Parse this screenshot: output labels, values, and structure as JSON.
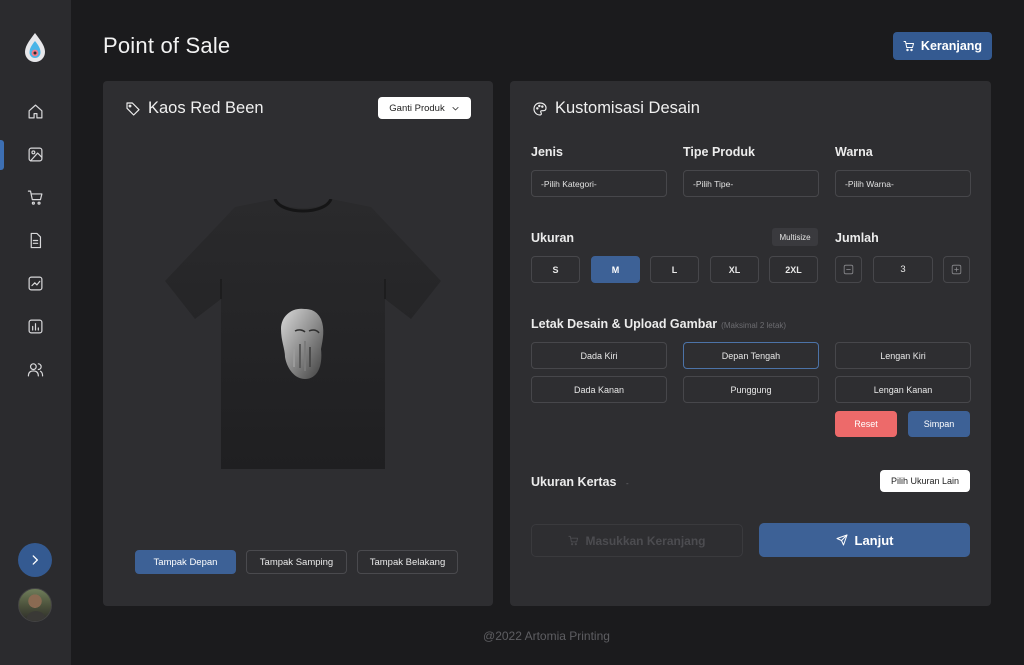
{
  "header": {
    "title": "Point of Sale",
    "cart_label": "Keranjang"
  },
  "sidebar": {
    "items": [
      {
        "icon": "home-icon"
      },
      {
        "icon": "image-icon",
        "active": true
      },
      {
        "icon": "cart-icon"
      },
      {
        "icon": "document-icon"
      },
      {
        "icon": "trend-chart-icon"
      },
      {
        "icon": "bar-chart-icon"
      },
      {
        "icon": "users-icon"
      }
    ]
  },
  "product": {
    "name": "Kaos Red Been",
    "change_label": "Ganti Produk",
    "views": [
      "Tampak Depan",
      "Tampak Samping",
      "Tampak Belakang"
    ],
    "active_view": "Tampak Depan"
  },
  "custom": {
    "title": "Kustomisasi Desain",
    "jenis_label": "Jenis",
    "jenis_value": "-Pilih Kategori-",
    "tipe_label": "Tipe Produk",
    "tipe_value": "-Pilih Tipe-",
    "warna_label": "Warna",
    "warna_value": "-Pilih Warna-",
    "ukuran_label": "Ukuran",
    "multisize_label": "Multisize",
    "sizes": [
      "S",
      "M",
      "L",
      "XL",
      "2XL"
    ],
    "selected_size": "M",
    "jumlah_label": "Jumlah",
    "jumlah_value": "3",
    "letak_label": "Letak Desain & Upload Gambar",
    "letak_note": "(Maksimal 2 letak)",
    "placements": [
      "Dada Kiri",
      "Depan Tengah",
      "Lengan Kiri",
      "Dada Kanan",
      "Punggung",
      "Lengan Kanan"
    ],
    "selected_placement": "Depan Tengah",
    "reset_label": "Reset",
    "save_label": "Simpan",
    "kertas_label": "Ukuran Kertas",
    "kertas_dash": "-",
    "kertas_button": "Pilih Ukuran Lain",
    "add_cart_label": "Masukkan Keranjang",
    "next_label": "Lanjut"
  },
  "footer": {
    "text": "@2022 Artomia Printing"
  },
  "colors": {
    "accent": "#3d6196",
    "danger": "#ed6a6a",
    "panel": "#2e2e31",
    "background": "#1b1b1d"
  }
}
